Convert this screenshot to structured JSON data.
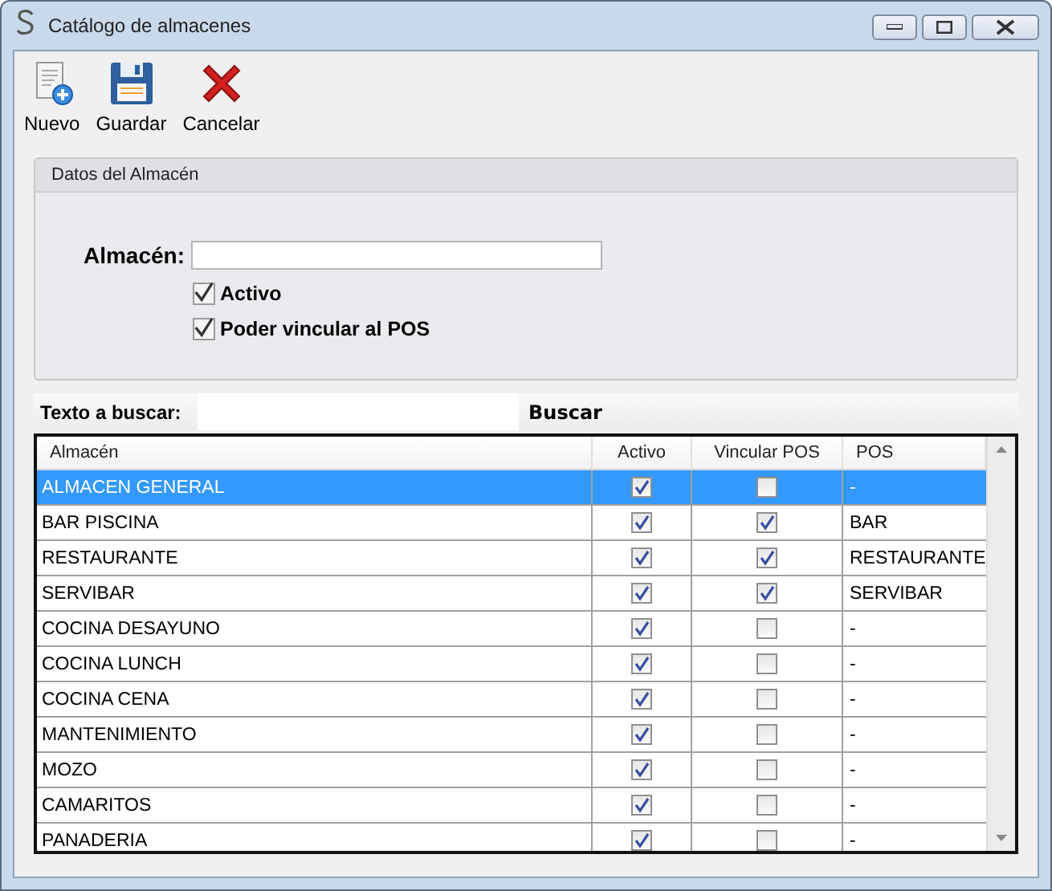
{
  "window": {
    "title": "Catálogo de almacenes"
  },
  "toolbar": [
    {
      "kind": "new",
      "label": "Nuevo"
    },
    {
      "kind": "save",
      "label": "Guardar"
    },
    {
      "kind": "cancel",
      "label": "Cancelar"
    }
  ],
  "group": {
    "title": "Datos del Almacén",
    "field_label": "Almacén:",
    "active": {
      "label": "Activo",
      "checked": true
    },
    "link_pos": {
      "label": "Poder vincular al POS",
      "checked": true
    }
  },
  "search": {
    "label": "Texto a buscar:",
    "button": "Buscar"
  },
  "table": {
    "columns": [
      "Almacén",
      "Activo",
      "Vincular POS",
      "POS"
    ],
    "rows": [
      {
        "name": "ALMACEN GENERAL",
        "active": true,
        "link": false,
        "pos": "-",
        "selected": true
      },
      {
        "name": "BAR PISCINA",
        "active": true,
        "link": true,
        "pos": "BAR",
        "selected": false
      },
      {
        "name": "RESTAURANTE",
        "active": true,
        "link": true,
        "pos": "RESTAURANTE",
        "selected": false
      },
      {
        "name": "SERVIBAR",
        "active": true,
        "link": true,
        "pos": "SERVIBAR",
        "selected": false
      },
      {
        "name": "COCINA DESAYUNO",
        "active": true,
        "link": false,
        "pos": "-",
        "selected": false
      },
      {
        "name": "COCINA LUNCH",
        "active": true,
        "link": false,
        "pos": "-",
        "selected": false
      },
      {
        "name": "COCINA CENA",
        "active": true,
        "link": false,
        "pos": "-",
        "selected": false
      },
      {
        "name": "MANTENIMIENTO",
        "active": true,
        "link": false,
        "pos": "-",
        "selected": false
      },
      {
        "name": "MOZO",
        "active": true,
        "link": false,
        "pos": "-",
        "selected": false
      },
      {
        "name": "CAMARITOS",
        "active": true,
        "link": false,
        "pos": "-",
        "selected": false
      },
      {
        "name": "PANADERIA",
        "active": true,
        "link": false,
        "pos": "-",
        "selected": false
      }
    ]
  }
}
